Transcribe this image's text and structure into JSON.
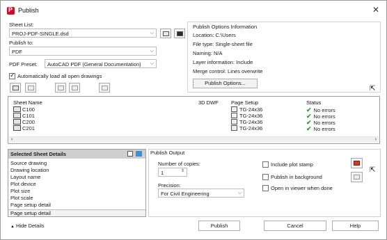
{
  "window": {
    "title": "Publish",
    "close_glyph": "✕"
  },
  "sheet_list": {
    "label": "Sheet List:",
    "value": "PROJ-PDF-SINGLE.dsd"
  },
  "publish_to": {
    "label": "Publish to:",
    "value": "PDF"
  },
  "pdf_preset": {
    "label": "PDF Preset:",
    "value": "AutoCAD PDF (General Documentation)"
  },
  "auto_load": {
    "label": "Automatically load all open drawings",
    "checked": true
  },
  "publish_options": {
    "heading": "Publish Options Information",
    "location": "Location: C:\\Users",
    "file_type": "File type: Single-sheet file",
    "naming": "Naming: N/A",
    "layer_info": "Layer information: Include",
    "merge_control": "Merge control: Lines overwrite",
    "button": "Publish Options..."
  },
  "table": {
    "columns": [
      "Sheet Name",
      "3D DWF",
      "Page Setup",
      "Status"
    ],
    "rows": [
      {
        "name": "C100",
        "page_setup": "TG-24x36",
        "status": "No errors"
      },
      {
        "name": "C101",
        "page_setup": "TG-24x36",
        "status": "No errors"
      },
      {
        "name": "C200",
        "page_setup": "TG-24x36",
        "status": "No errors"
      },
      {
        "name": "C201",
        "page_setup": "TG-24x36",
        "status": "No errors"
      }
    ]
  },
  "selected_details": {
    "heading": "Selected Sheet Details",
    "items": [
      "Source drawing",
      "Drawing location",
      "Layout name",
      "Plot device",
      "Plot size",
      "Plot scale",
      "Page setup detail"
    ],
    "footer": "Page setup detail"
  },
  "publish_output": {
    "heading": "Publish Output",
    "copies_label": "Number of copies:",
    "copies_value": "1",
    "precision_label": "Precision:",
    "precision_value": "For Civil Engineering",
    "include_stamp": "Include plot stamp",
    "publish_background": "Publish in background",
    "open_viewer": "Open in viewer when done"
  },
  "footer": {
    "hide_details": "Hide Details",
    "publish": "Publish",
    "cancel": "Cancel",
    "help": "Help"
  },
  "colors": {
    "status_ok": "#2f9e3e",
    "app_icon": "#c8102e",
    "details_header": "#cfcfcf"
  }
}
